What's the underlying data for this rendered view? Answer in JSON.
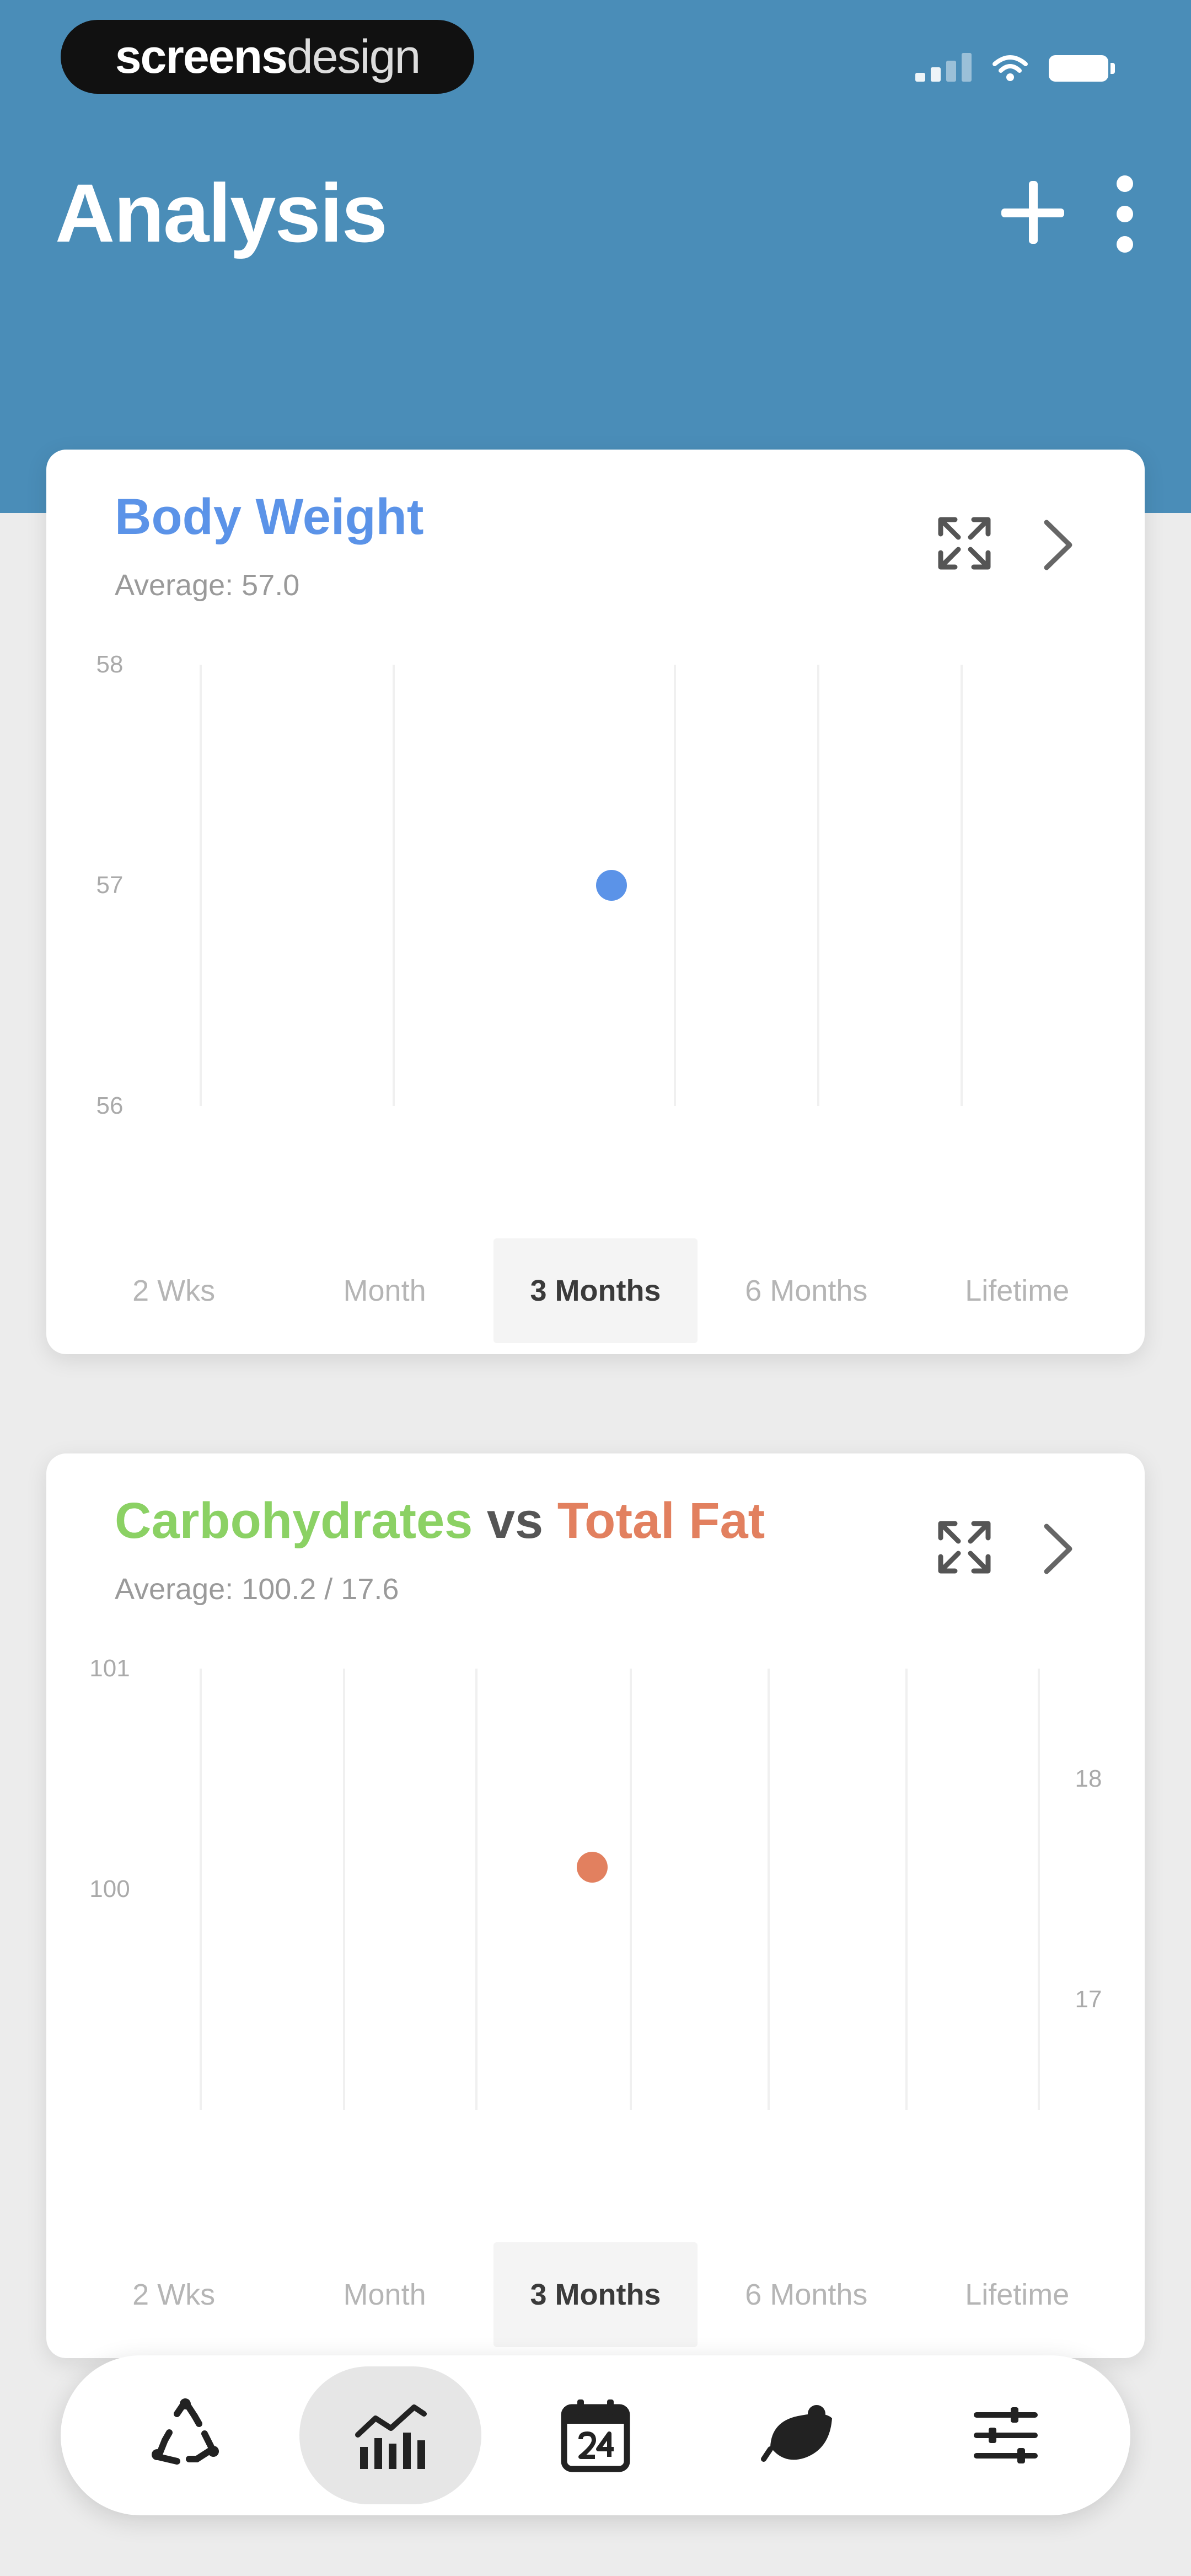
{
  "status_bar": {
    "brand_bold": "screens",
    "brand_light": "design"
  },
  "header": {
    "title": "Analysis",
    "add_icon": "plus-icon",
    "more_icon": "more-vertical-icon"
  },
  "cards": [
    {
      "title": "Body Weight",
      "title_color": "#5b93e8",
      "subtitle": "Average: 57.0",
      "periods": [
        "2 Wks",
        "Month",
        "3 Months",
        "6 Months",
        "Lifetime"
      ],
      "selected_period": "3 Months",
      "chart_data": {
        "type": "scatter",
        "series": [
          {
            "name": "Body Weight",
            "color": "#5b93e8",
            "points": [
              {
                "x": 0.5,
                "y": 57
              }
            ]
          }
        ],
        "y_ticks": [
          "58",
          "57",
          "56"
        ],
        "ylim": [
          56,
          58
        ],
        "grid": true
      }
    },
    {
      "title_part1": "Carbohydrates",
      "title_part1_color": "#8bd164",
      "title_vs": "vs",
      "title_part2": "Total Fat",
      "title_part2_color": "#e2805f",
      "subtitle": "Average: 100.2 / 17.6",
      "periods": [
        "2 Wks",
        "Month",
        "3 Months",
        "6 Months",
        "Lifetime"
      ],
      "selected_period": "3 Months",
      "chart_data": {
        "type": "scatter",
        "series": [
          {
            "name": "Total Fat",
            "color": "#e2805f",
            "axis": "right",
            "points": [
              {
                "x": 0.5,
                "y": 17.6
              }
            ]
          }
        ],
        "y_left_ticks": [
          "101",
          "100"
        ],
        "y_right_ticks": [
          "18",
          "17"
        ],
        "ylim_left": [
          99,
          101
        ],
        "ylim_right": [
          16.5,
          18.5
        ],
        "grid": true
      }
    }
  ],
  "bottom_nav": {
    "items": [
      {
        "icon": "recycle-icon"
      },
      {
        "icon": "analytics-chart-icon",
        "active": true
      },
      {
        "icon": "calendar-24-icon"
      },
      {
        "icon": "food-icon"
      },
      {
        "icon": "sliders-icon"
      }
    ]
  }
}
